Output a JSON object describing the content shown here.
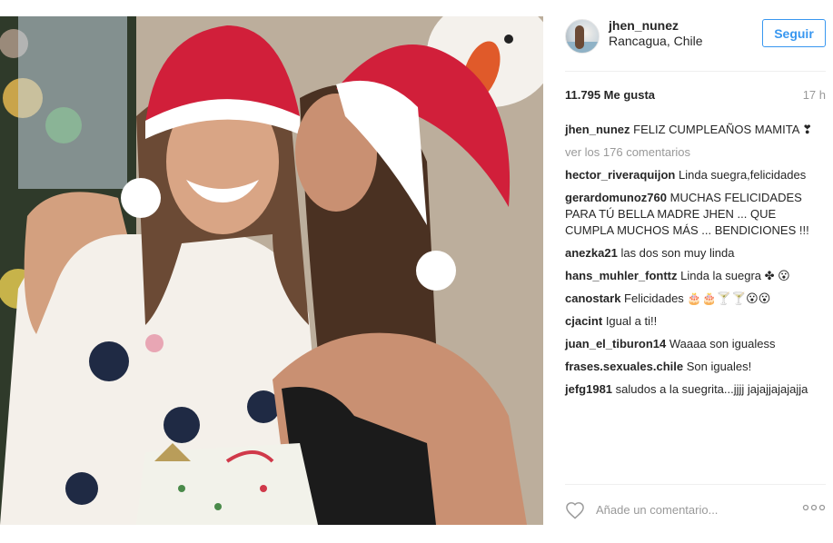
{
  "post": {
    "photo_alt": "",
    "author": {
      "username": "jhen_nunez",
      "location": "Rancagua, Chile",
      "avatar_icon": "avatar-photo"
    },
    "follow_label": "Seguir",
    "likes": "11.795 Me gusta",
    "time_ago": "17 h",
    "caption": {
      "author": "jhen_nunez",
      "text": "FELIZ CUMPLEAÑOS MAMITA ❣"
    },
    "view_all_label": "ver los 176 comentarios",
    "comments": [
      {
        "author": "hector_riveraquijon",
        "text": "Linda suegra,felicidades"
      },
      {
        "author": "gerardomunoz760",
        "text": "MUCHAS FELICIDADES PARA TÚ BELLA MADRE JHEN ... QUE CUMPLA MUCHOS MÁS ... BENDICIONES !!!"
      },
      {
        "author": "anezka21",
        "text": "las dos son muy linda"
      },
      {
        "author": "hans_muhler_fonttz",
        "text": "Linda la suegra ✤ 😮"
      },
      {
        "author": "canostark",
        "text": "Felicidades 🎂🎂🍸🍸😮😮"
      },
      {
        "author": "cjacint",
        "text": "Igual a ti!!"
      },
      {
        "author": "juan_el_tiburon14",
        "text": "Waaaa son igualess"
      },
      {
        "author": "frases.sexuales.chile",
        "text": "Son iguales!"
      },
      {
        "author": "jefg1981",
        "text": "saludos a la suegrita...jjjj jajajjajajajja"
      }
    ],
    "add_comment_placeholder": "Añade un comentario...",
    "icons": {
      "like": "heart-icon",
      "more": "more-options-icon"
    },
    "colors": {
      "accent": "#3897f0",
      "muted": "#999999",
      "text": "#262626",
      "divider": "#efefef"
    }
  }
}
